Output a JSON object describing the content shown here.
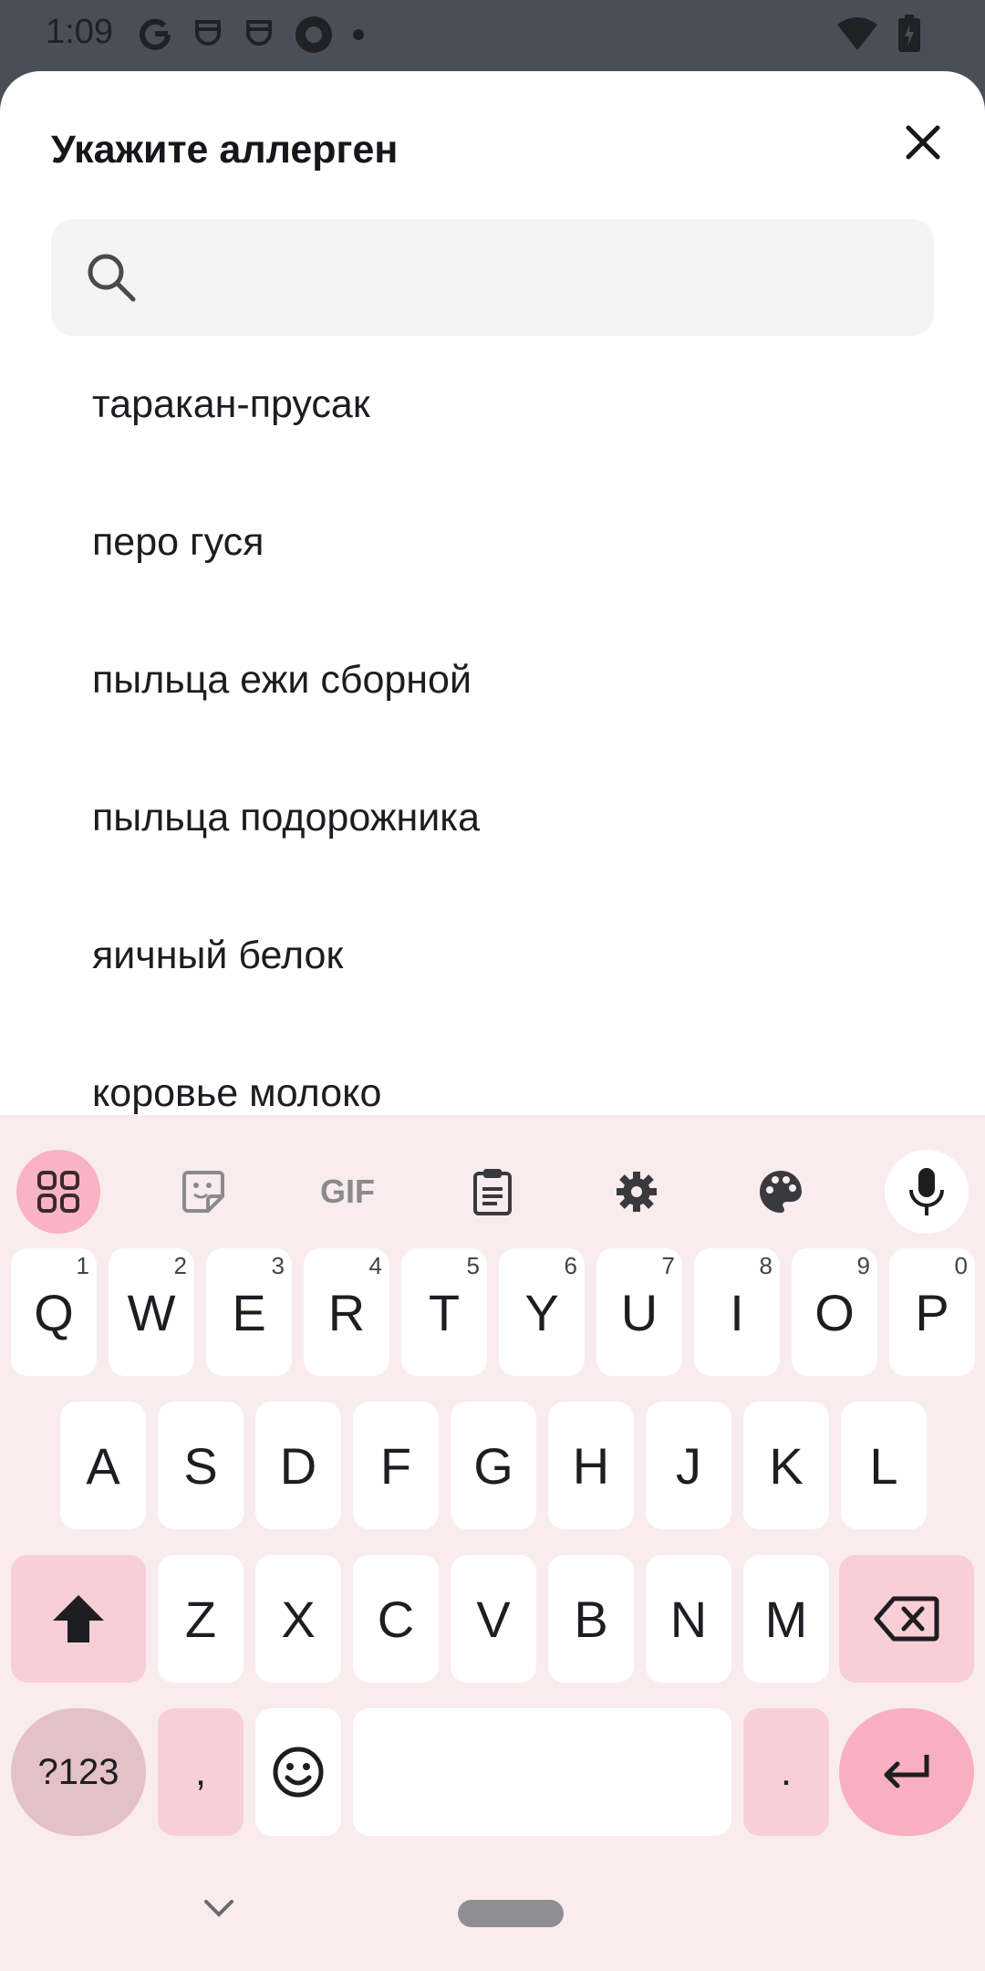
{
  "status_bar": {
    "time": "1:09",
    "icons": [
      "google-icon",
      "notification-face-icon",
      "notification-face-icon",
      "vpn-icon",
      "dot-icon"
    ],
    "right_icons": [
      "wifi-icon",
      "battery-icon"
    ]
  },
  "sheet": {
    "title": "Укажите аллерген",
    "search": {
      "value": "",
      "placeholder": ""
    },
    "items": [
      "таракан-прусак",
      "перо гуся",
      "пыльца ежи сборной",
      "пыльца подорожника",
      "яичный белок",
      "коровье молоко"
    ]
  },
  "keyboard": {
    "toolbar": [
      "apps-grid-icon",
      "sticker-icon",
      "GIF",
      "clipboard-icon",
      "settings-icon",
      "palette-icon",
      "microphone-icon"
    ],
    "row1": [
      {
        "label": "Q",
        "num": "1"
      },
      {
        "label": "W",
        "num": "2"
      },
      {
        "label": "E",
        "num": "3"
      },
      {
        "label": "R",
        "num": "4"
      },
      {
        "label": "T",
        "num": "5"
      },
      {
        "label": "Y",
        "num": "6"
      },
      {
        "label": "U",
        "num": "7"
      },
      {
        "label": "I",
        "num": "8"
      },
      {
        "label": "O",
        "num": "9"
      },
      {
        "label": "P",
        "num": "0"
      }
    ],
    "row2": [
      "A",
      "S",
      "D",
      "F",
      "G",
      "H",
      "J",
      "K",
      "L"
    ],
    "row3": [
      "Z",
      "X",
      "C",
      "V",
      "B",
      "N",
      "M"
    ],
    "symbols_label": "?123",
    "comma_label": ",",
    "period_label": "."
  },
  "colors": {
    "keyboard_bg": "#f9ecee",
    "accent_pink": "#f8b0c0",
    "mod_key": "#f8cfd7"
  }
}
